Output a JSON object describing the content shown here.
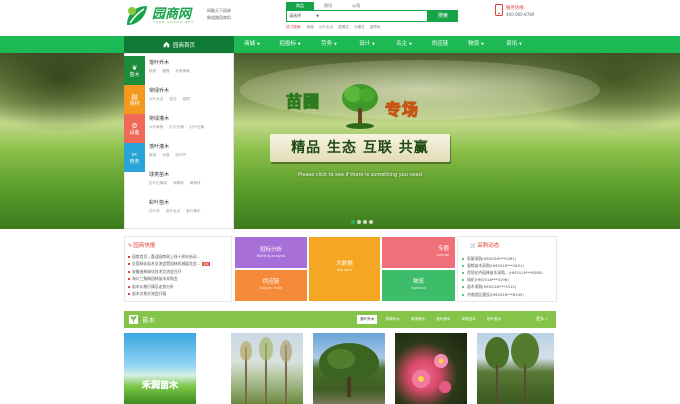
{
  "header": {
    "logo_text": "园商网",
    "logo_sub": "YUAN SHANG NET",
    "slogan_line1": "网聚天下园林",
    "slogan_line2": "做道路园商机",
    "search": {
      "tabs": [
        "商品",
        "资讯",
        "公司"
      ],
      "active_tab": "商品",
      "select_label": "请选择",
      "button_label": "搜索",
      "hot_label": "热门搜索:",
      "hot_words": [
        "紫薇",
        "小叶女贞",
        "蓝莓花",
        "大樱花",
        "香樟树"
      ]
    },
    "hotline_label": "服务热线:",
    "hotline_number": "400-000-8789"
  },
  "nav": {
    "home_label": "园商首页",
    "items": [
      {
        "label": "商城",
        "dropdown": true
      },
      {
        "label": "招投标",
        "dropdown": true
      },
      {
        "label": "劳务",
        "dropdown": true
      },
      {
        "label": "设计",
        "dropdown": true
      },
      {
        "label": "名企",
        "dropdown": true
      },
      {
        "label": "供应链",
        "dropdown": false
      },
      {
        "label": "物流",
        "dropdown": true
      },
      {
        "label": "资讯",
        "dropdown": true
      }
    ]
  },
  "banner": {
    "logo_left": "苗圃",
    "logo_right": "专场",
    "tagline": "精品 生态 互联 共赢",
    "caption": "Please click to see if there is something you need",
    "dots": 4,
    "active_dot": 0
  },
  "categories": {
    "tabs": [
      {
        "label": "苗木",
        "icon": "seedling-icon",
        "color": "#1a8c3a"
      },
      {
        "label": "资材",
        "icon": "material-icon",
        "color": "#f29a1f"
      },
      {
        "label": "设备",
        "icon": "equipment-icon",
        "color": "#f06a5a"
      },
      {
        "label": "劳务",
        "icon": "labor-icon",
        "color": "#2aa3d8"
      }
    ],
    "items": [
      {
        "title": "落叶乔木",
        "subs": [
          "柳类",
          "圆槐",
          "北美海棠"
        ]
      },
      {
        "title": "常绿乔木",
        "subs": [
          "大叶女贞",
          "桂花",
          "香樟"
        ]
      },
      {
        "title": "常绿灌木",
        "subs": [
          "大叶黄杨",
          "红叶石楠",
          "红叶石楠"
        ]
      },
      {
        "title": "落叶灌木",
        "subs": [
          "紫荆",
          "木槿",
          "碰叶柠"
        ]
      },
      {
        "title": "球类苗木",
        "subs": [
          "红叶石楠球",
          "海桐球",
          "黄杨球"
        ]
      },
      {
        "title": "彩叶苗木",
        "subs": [
          "红叶李",
          "金叶女贞",
          "紫叶黄栌"
        ]
      }
    ]
  },
  "quick_news": {
    "title": "园商快报",
    "items": [
      {
        "text": "园商首页 | 喜迎园商网上线十周年启动...",
        "badge": ""
      },
      {
        "text": "全国绿化苗木交流会暨园林机械展览会...",
        "badge": "最新"
      },
      {
        "text": "安徽造林绿化技术交流会召开",
        "badge": ""
      },
      {
        "text": "海口三角梅园林苗木采购会",
        "badge": ""
      },
      {
        "text": "苗木价格行情及走势分析",
        "badge": ""
      },
      {
        "text": "苗木交易交流会开幕",
        "badge": ""
      }
    ]
  },
  "tiles": [
    {
      "title": "招标分析",
      "subtitle": "Bidding analysis",
      "color": "#a96fd8"
    },
    {
      "title": "大数据",
      "subtitle": "Big data",
      "color": "#f5a623"
    },
    {
      "title": "专题",
      "subtitle": "special",
      "color": "#f0707a"
    },
    {
      "title": "供应链",
      "subtitle": "Supply chain",
      "color": "#f58a3a"
    },
    {
      "title": "物流",
      "subtitle": "logistics",
      "color": "#3dbd6a"
    }
  ],
  "purchase": {
    "title": "采购动态",
    "items": [
      "豪屋采购(HM2018***0281)",
      "瓷都苗木采购(HM2018***1851)",
      "西坝花卉园林苗木采购...(HM2018***8580)",
      "绿花(HM2018***0196)",
      "苗木采购(HM2018***3512)",
      "济南园区建设(HM2018***6345)"
    ]
  },
  "seedlings": {
    "title": "苗木",
    "tabs": [
      "落叶乔木",
      "常绿乔木",
      "常绿灌木",
      "落叶灌木",
      "球类苗木",
      "彩叶苗木"
    ],
    "active_tab": 0,
    "more_label": "更多",
    "photo1_text": "禾润苗木"
  }
}
